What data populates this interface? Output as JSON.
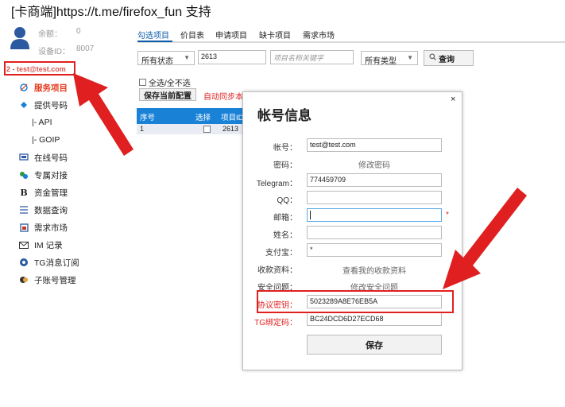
{
  "banner": {
    "text": "[卡商端]https://t.me/firefox_fun 支持"
  },
  "account": {
    "balance_label": "余额：",
    "balance_value": "0",
    "device_label": "设备ID：",
    "device_value": "8007",
    "user_tag": "2 - test@test.com"
  },
  "sidebar": {
    "items": [
      {
        "label": "服务项目",
        "icon": "service-icon",
        "active": true
      },
      {
        "label": "提供号码",
        "icon": "diamond-icon",
        "active": false
      },
      {
        "label": "|- API",
        "icon": "",
        "active": false
      },
      {
        "label": "|- GOIP",
        "icon": "",
        "active": false
      },
      {
        "label": "在线号码",
        "icon": "online-icon",
        "active": false
      },
      {
        "label": "专属对接",
        "icon": "connect-icon",
        "active": false
      },
      {
        "label": "资金管理",
        "icon": "b-icon",
        "active": false
      },
      {
        "label": "数据查询",
        "icon": "list-icon",
        "active": false
      },
      {
        "label": "需求市场",
        "icon": "market-icon",
        "active": false
      },
      {
        "label": "IM 记录",
        "icon": "mail-icon",
        "active": false
      },
      {
        "label": "TG消息订阅",
        "icon": "tg-icon",
        "active": false
      },
      {
        "label": "子账号管理",
        "icon": "subaccount-icon",
        "active": false
      }
    ]
  },
  "tabs": [
    "勾选项目",
    "价目表",
    "申请项目",
    "缺卡项目",
    "需求市场"
  ],
  "filters": {
    "status_select": "所有状态",
    "code_input": "2613",
    "keyword_placeholder": "项目名称关键字",
    "type_select": "所有类型",
    "query_label": "查询"
  },
  "toolbar": {
    "select_all": "全选/全不选",
    "save_config": "保存当前配置",
    "auto_sync": "自动同步本"
  },
  "table": {
    "headers": [
      "序号",
      "选择",
      "项目ID"
    ],
    "rows": [
      {
        "index": "1",
        "project_id": "2613"
      }
    ]
  },
  "dialog": {
    "title": "帐号信息",
    "close": "×",
    "account_label": "帐号：",
    "account_value": "test@test.com",
    "password_label": "密码：",
    "password_link": "修改密码",
    "telegram_label": "Telegram：",
    "telegram_value": "774459709",
    "qq_label": "QQ：",
    "qq_value": "",
    "email_label": "邮箱：",
    "email_value": "",
    "name_label": "姓名：",
    "name_value": "",
    "alipay_label": "支付宝：",
    "alipay_value": "*",
    "payment_label": "收款资料：",
    "payment_link": "查看我的收款资料",
    "security_label": "安全问题：",
    "security_link": "修改安全问题",
    "protocol_key_label": "协议密钥：",
    "protocol_key_value": "5023289A8E76EB5A",
    "tg_bind_label": "TG绑定码：",
    "tg_bind_value": "BC24DCD6D27ECD68",
    "required_mark": "*",
    "save_label": "保存"
  },
  "colors": {
    "accent_blue": "#1a82d6",
    "highlight_red": "#e02020",
    "active_orange": "#e63c1e"
  }
}
